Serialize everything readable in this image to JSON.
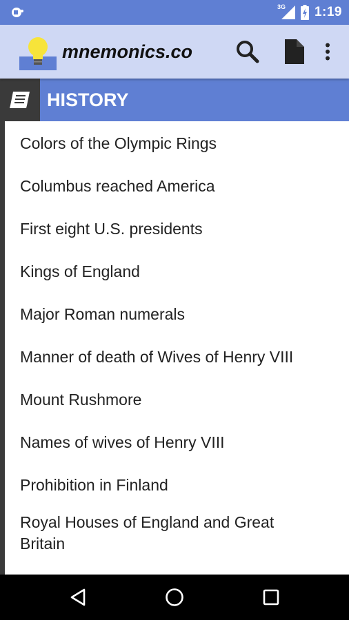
{
  "status_bar": {
    "time": "1:19",
    "network": "3G",
    "icons": [
      "notification-icon",
      "signal-icon",
      "battery-icon"
    ]
  },
  "app_bar": {
    "title": "mnemonics.co",
    "icons": [
      "lightbulb-logo-icon",
      "search-icon",
      "document-icon",
      "overflow-menu-icon"
    ]
  },
  "section": {
    "title": "HISTORY",
    "icon": "book-icon"
  },
  "list": {
    "items": [
      "Colors of the Olympic Rings",
      "Columbus reached America",
      "First eight U.S. presidents",
      "Kings of England",
      "Major Roman numerals",
      "Manner of death of Wives of Henry VIII",
      "Mount Rushmore",
      "Names of wives of Henry VIII",
      "Prohibition in Finland",
      "Royal Houses of England and Great Britain"
    ]
  },
  "nav_bar": {
    "icons": [
      "back-icon",
      "home-icon",
      "recents-icon"
    ]
  },
  "colors": {
    "primary": "#5f7fd3",
    "app_bar_bg": "#cfd8f4",
    "dark_accent": "#3a3a3a"
  }
}
